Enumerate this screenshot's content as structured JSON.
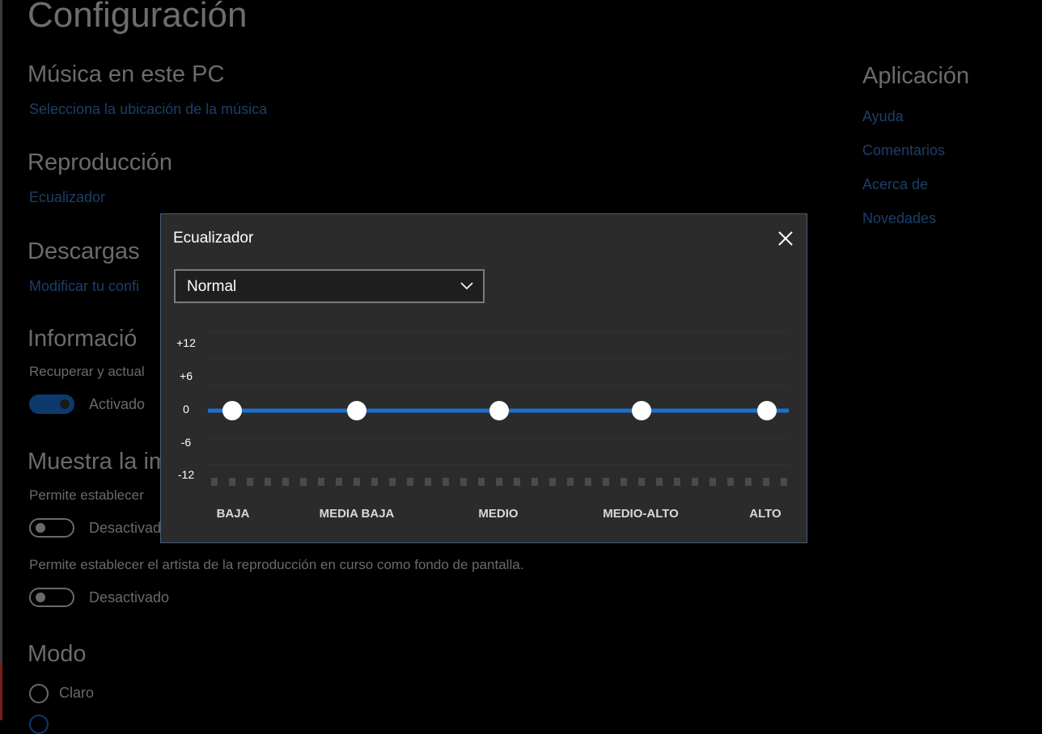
{
  "page": {
    "title": "Configuración"
  },
  "sections": {
    "music": {
      "heading": "Música en este PC",
      "link": "Selecciona la ubicación de la música"
    },
    "playback": {
      "heading": "Reproducción",
      "link": "Ecualizador"
    },
    "downloads": {
      "heading": "Descargas",
      "link": "Modificar tu confi"
    },
    "info": {
      "heading": "Informació",
      "desc": "Recuperar y actual",
      "toggle_label": "Activado"
    },
    "show": {
      "heading": "Muestra la im",
      "desc1": "Permite establecer",
      "toggle1_label": "Desactivad",
      "desc2": "Permite establecer el artista de la reproducción en curso como fondo de pantalla.",
      "toggle2_label": "Desactivado"
    },
    "mode": {
      "heading": "Modo",
      "option1": "Claro"
    }
  },
  "sidebar": {
    "heading": "Aplicación",
    "links": [
      "Ayuda",
      "Comentarios",
      "Acerca de",
      "Novedades"
    ]
  },
  "equalizer": {
    "title": "Ecualizador",
    "preset": "Normal",
    "db_labels": [
      "+12",
      "+6",
      "0",
      "-6",
      "-12"
    ],
    "bands": [
      {
        "label": "BAJA",
        "gain": 0
      },
      {
        "label": "MEDIA BAJA",
        "gain": 0
      },
      {
        "label": "MEDIO",
        "gain": 0
      },
      {
        "label": "MEDIO-ALTO",
        "gain": 0
      },
      {
        "label": "ALTO",
        "gain": 0
      }
    ],
    "db_range": [
      -12,
      12
    ]
  },
  "colors": {
    "accent": "#1e6fd0",
    "link": "#1c3f68",
    "dialog_bg": "#2b2b2b",
    "grid_dot": "#4a4a4a"
  }
}
